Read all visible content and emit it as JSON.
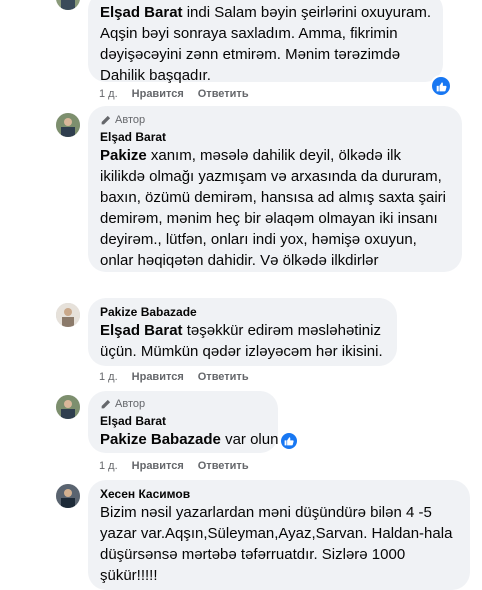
{
  "comments": [
    {
      "id": "c1",
      "author": "Elşad Barat",
      "text": "indi Salam bəyin şeirlərini oxuyuram. Aqşin bəyi sonraya saxladım. Amma, fikrimin dəyişəcəyini zənn etmirəm. Mənim tərəzimdə Dahilik başqadır.",
      "time": "1 д.",
      "like_label": "Нравится",
      "reply_label": "Ответить",
      "has_reaction": true
    },
    {
      "id": "c2",
      "badge": "Автор",
      "author": "Elşad Barat",
      "mention": "Pakize",
      "text": "xanım, məsələ dahilik deyil, ölkədə ilk ikilikdə olmağı yazmışam və arxasında da dururam, baxın, özümü demirəm, hansısa ad almış saxta şairi demirəm, mənim heç bir əlaqəm olmayan iki insanı deyirəm., lütfən, onları indi yox, həmişə oxuyun, onlar həqiqətən dahidir. Və ölkədə ilkdirlər",
      "time": "",
      "like_label": "",
      "reply_label": ""
    },
    {
      "id": "c3",
      "author": "Pakize Babazade",
      "mention": "Elşad Barat",
      "text": "təşəkkür edirəm məsləhətiniz üçün. Mümkün qədər izləyəcəm hər ikisini.",
      "time": "1 д.",
      "like_label": "Нравится",
      "reply_label": "Ответить"
    },
    {
      "id": "c4",
      "badge": "Автор",
      "author": "Elşad Barat",
      "mention": "Pakize Babazade",
      "text": "var olun",
      "time": "1 д.",
      "like_label": "Нравится",
      "reply_label": "Ответить",
      "has_reaction": true
    },
    {
      "id": "c5",
      "author": "Хесен Касимов",
      "text": "Bizim nəsil yazarlardan məni düşündürə bilən 4 -5 yazar var.Aqşın,Süleyman,Ayaz,Sarvan. Haldan-hala düşürsənsə mərtəbə təfərruatdır. Sizlərə 1000 şükür!!!!!"
    }
  ],
  "colors": {
    "bubble_bg": "#f0f2f5",
    "meta_text": "#65676b",
    "like_blue": "#1877f2"
  },
  "icons": {
    "author_badge": "pencil-icon",
    "reaction": "thumbs-up-icon"
  }
}
